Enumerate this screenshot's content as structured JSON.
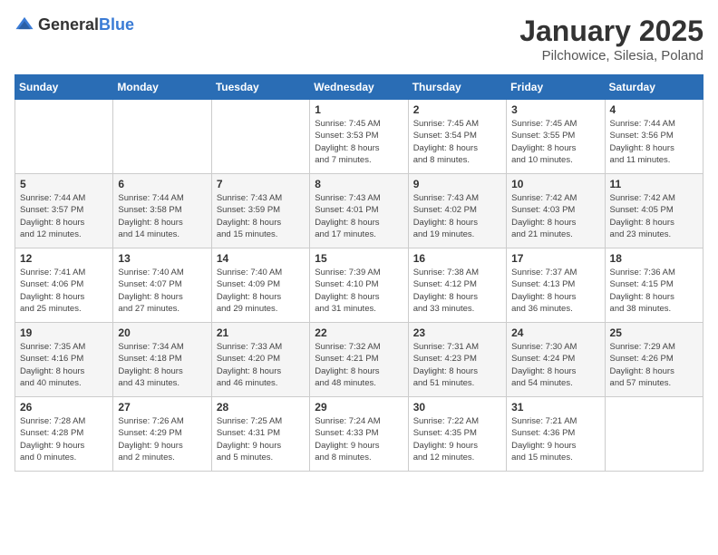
{
  "logo": {
    "general": "General",
    "blue": "Blue"
  },
  "title": "January 2025",
  "location": "Pilchowice, Silesia, Poland",
  "weekdays": [
    "Sunday",
    "Monday",
    "Tuesday",
    "Wednesday",
    "Thursday",
    "Friday",
    "Saturday"
  ],
  "weeks": [
    [
      {
        "day": "",
        "info": ""
      },
      {
        "day": "",
        "info": ""
      },
      {
        "day": "",
        "info": ""
      },
      {
        "day": "1",
        "info": "Sunrise: 7:45 AM\nSunset: 3:53 PM\nDaylight: 8 hours\nand 7 minutes."
      },
      {
        "day": "2",
        "info": "Sunrise: 7:45 AM\nSunset: 3:54 PM\nDaylight: 8 hours\nand 8 minutes."
      },
      {
        "day": "3",
        "info": "Sunrise: 7:45 AM\nSunset: 3:55 PM\nDaylight: 8 hours\nand 10 minutes."
      },
      {
        "day": "4",
        "info": "Sunrise: 7:44 AM\nSunset: 3:56 PM\nDaylight: 8 hours\nand 11 minutes."
      }
    ],
    [
      {
        "day": "5",
        "info": "Sunrise: 7:44 AM\nSunset: 3:57 PM\nDaylight: 8 hours\nand 12 minutes."
      },
      {
        "day": "6",
        "info": "Sunrise: 7:44 AM\nSunset: 3:58 PM\nDaylight: 8 hours\nand 14 minutes."
      },
      {
        "day": "7",
        "info": "Sunrise: 7:43 AM\nSunset: 3:59 PM\nDaylight: 8 hours\nand 15 minutes."
      },
      {
        "day": "8",
        "info": "Sunrise: 7:43 AM\nSunset: 4:01 PM\nDaylight: 8 hours\nand 17 minutes."
      },
      {
        "day": "9",
        "info": "Sunrise: 7:43 AM\nSunset: 4:02 PM\nDaylight: 8 hours\nand 19 minutes."
      },
      {
        "day": "10",
        "info": "Sunrise: 7:42 AM\nSunset: 4:03 PM\nDaylight: 8 hours\nand 21 minutes."
      },
      {
        "day": "11",
        "info": "Sunrise: 7:42 AM\nSunset: 4:05 PM\nDaylight: 8 hours\nand 23 minutes."
      }
    ],
    [
      {
        "day": "12",
        "info": "Sunrise: 7:41 AM\nSunset: 4:06 PM\nDaylight: 8 hours\nand 25 minutes."
      },
      {
        "day": "13",
        "info": "Sunrise: 7:40 AM\nSunset: 4:07 PM\nDaylight: 8 hours\nand 27 minutes."
      },
      {
        "day": "14",
        "info": "Sunrise: 7:40 AM\nSunset: 4:09 PM\nDaylight: 8 hours\nand 29 minutes."
      },
      {
        "day": "15",
        "info": "Sunrise: 7:39 AM\nSunset: 4:10 PM\nDaylight: 8 hours\nand 31 minutes."
      },
      {
        "day": "16",
        "info": "Sunrise: 7:38 AM\nSunset: 4:12 PM\nDaylight: 8 hours\nand 33 minutes."
      },
      {
        "day": "17",
        "info": "Sunrise: 7:37 AM\nSunset: 4:13 PM\nDaylight: 8 hours\nand 36 minutes."
      },
      {
        "day": "18",
        "info": "Sunrise: 7:36 AM\nSunset: 4:15 PM\nDaylight: 8 hours\nand 38 minutes."
      }
    ],
    [
      {
        "day": "19",
        "info": "Sunrise: 7:35 AM\nSunset: 4:16 PM\nDaylight: 8 hours\nand 40 minutes."
      },
      {
        "day": "20",
        "info": "Sunrise: 7:34 AM\nSunset: 4:18 PM\nDaylight: 8 hours\nand 43 minutes."
      },
      {
        "day": "21",
        "info": "Sunrise: 7:33 AM\nSunset: 4:20 PM\nDaylight: 8 hours\nand 46 minutes."
      },
      {
        "day": "22",
        "info": "Sunrise: 7:32 AM\nSunset: 4:21 PM\nDaylight: 8 hours\nand 48 minutes."
      },
      {
        "day": "23",
        "info": "Sunrise: 7:31 AM\nSunset: 4:23 PM\nDaylight: 8 hours\nand 51 minutes."
      },
      {
        "day": "24",
        "info": "Sunrise: 7:30 AM\nSunset: 4:24 PM\nDaylight: 8 hours\nand 54 minutes."
      },
      {
        "day": "25",
        "info": "Sunrise: 7:29 AM\nSunset: 4:26 PM\nDaylight: 8 hours\nand 57 minutes."
      }
    ],
    [
      {
        "day": "26",
        "info": "Sunrise: 7:28 AM\nSunset: 4:28 PM\nDaylight: 9 hours\nand 0 minutes."
      },
      {
        "day": "27",
        "info": "Sunrise: 7:26 AM\nSunset: 4:29 PM\nDaylight: 9 hours\nand 2 minutes."
      },
      {
        "day": "28",
        "info": "Sunrise: 7:25 AM\nSunset: 4:31 PM\nDaylight: 9 hours\nand 5 minutes."
      },
      {
        "day": "29",
        "info": "Sunrise: 7:24 AM\nSunset: 4:33 PM\nDaylight: 9 hours\nand 8 minutes."
      },
      {
        "day": "30",
        "info": "Sunrise: 7:22 AM\nSunset: 4:35 PM\nDaylight: 9 hours\nand 12 minutes."
      },
      {
        "day": "31",
        "info": "Sunrise: 7:21 AM\nSunset: 4:36 PM\nDaylight: 9 hours\nand 15 minutes."
      },
      {
        "day": "",
        "info": ""
      }
    ]
  ]
}
